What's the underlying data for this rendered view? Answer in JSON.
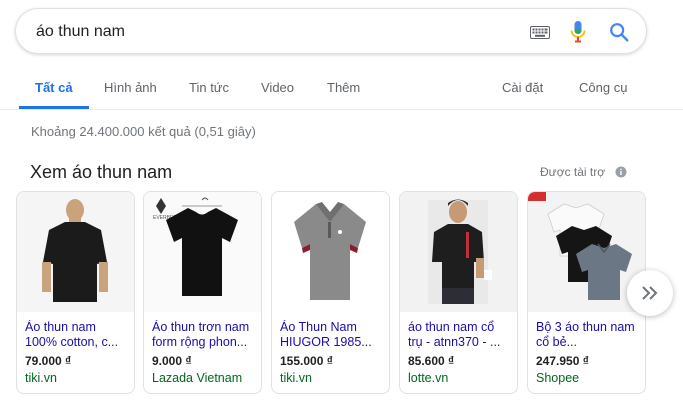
{
  "search": {
    "query": "áo thun nam",
    "icons": [
      "keyboard-icon",
      "microphone-icon",
      "search-icon"
    ]
  },
  "tabs": [
    {
      "label": "Tất cả",
      "active": true
    },
    {
      "label": "Hình ảnh"
    },
    {
      "label": "Tin tức"
    },
    {
      "label": "Video"
    },
    {
      "label": "Thêm"
    },
    {
      "label": "Cài đặt"
    },
    {
      "label": "Công cụ"
    }
  ],
  "results": {
    "stats": "Khoảng 24.400.000 kết quả (0,51 giây)"
  },
  "shopping": {
    "title": "Xem áo thun nam",
    "sponsored_label": "Được tài trợ",
    "products": [
      {
        "title": "Áo thun nam 100% cotton, c...",
        "price": "79.000 ₫",
        "store": "tiki.vn"
      },
      {
        "title": "Áo thun trơn nam form rộng phon...",
        "price": "9.000 ₫",
        "store": "Lazada Vietnam",
        "image_label": "EVERBEST"
      },
      {
        "title": "Áo Thun Nam HIUGOR 1985...",
        "price": "155.000 ₫",
        "store": "tiki.vn"
      },
      {
        "title": "áo thun nam cổ trụ - atnn370 - ...",
        "price": "85.600 ₫",
        "store": "lotte.vn"
      },
      {
        "title": "Bộ 3 áo thun nam cổ bẻ...",
        "price": "247.950 ₫",
        "store": "Shopee"
      }
    ]
  },
  "colors": {
    "accent": "#1a73e8",
    "link": "#1a0dab",
    "store": "#006621",
    "muted": "#70757a"
  }
}
